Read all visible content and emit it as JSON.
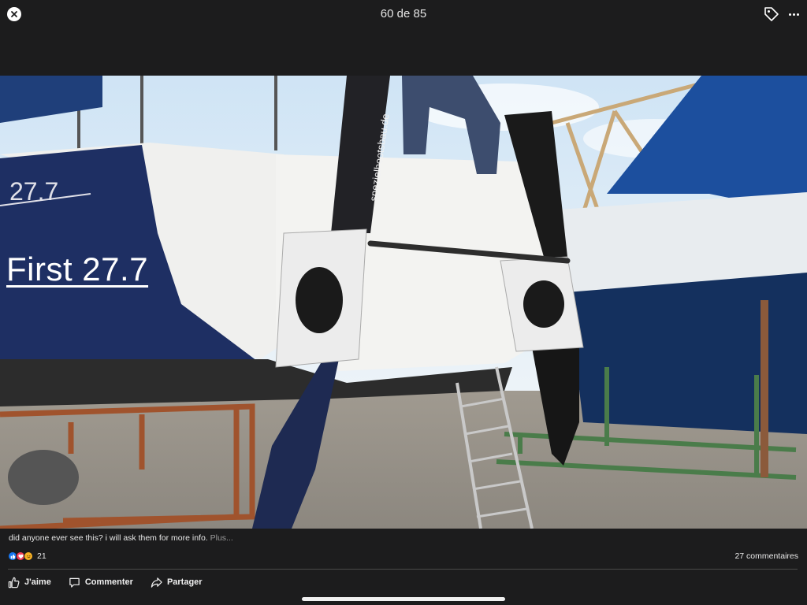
{
  "header": {
    "counter": "60 de 85",
    "close_icon": "close-icon",
    "tag_icon": "tag-icon",
    "more_icon": "more-icon"
  },
  "photo": {
    "overlay_text": "First 27.7",
    "hull_number": "27.7",
    "rudder_text": "spezielbootsbau.de"
  },
  "post": {
    "caption": "did anyone ever see this? i will ask them for more info.",
    "caption_more": "Plus...",
    "reaction_count": "21",
    "comments": "27 commentaires"
  },
  "actions": {
    "like": "J'aime",
    "comment": "Commenter",
    "share": "Partager"
  },
  "colors": {
    "background": "#1c1c1d",
    "like_blue": "#1877f2",
    "love_red": "#f33e58",
    "haha_yellow": "#f7b125"
  }
}
